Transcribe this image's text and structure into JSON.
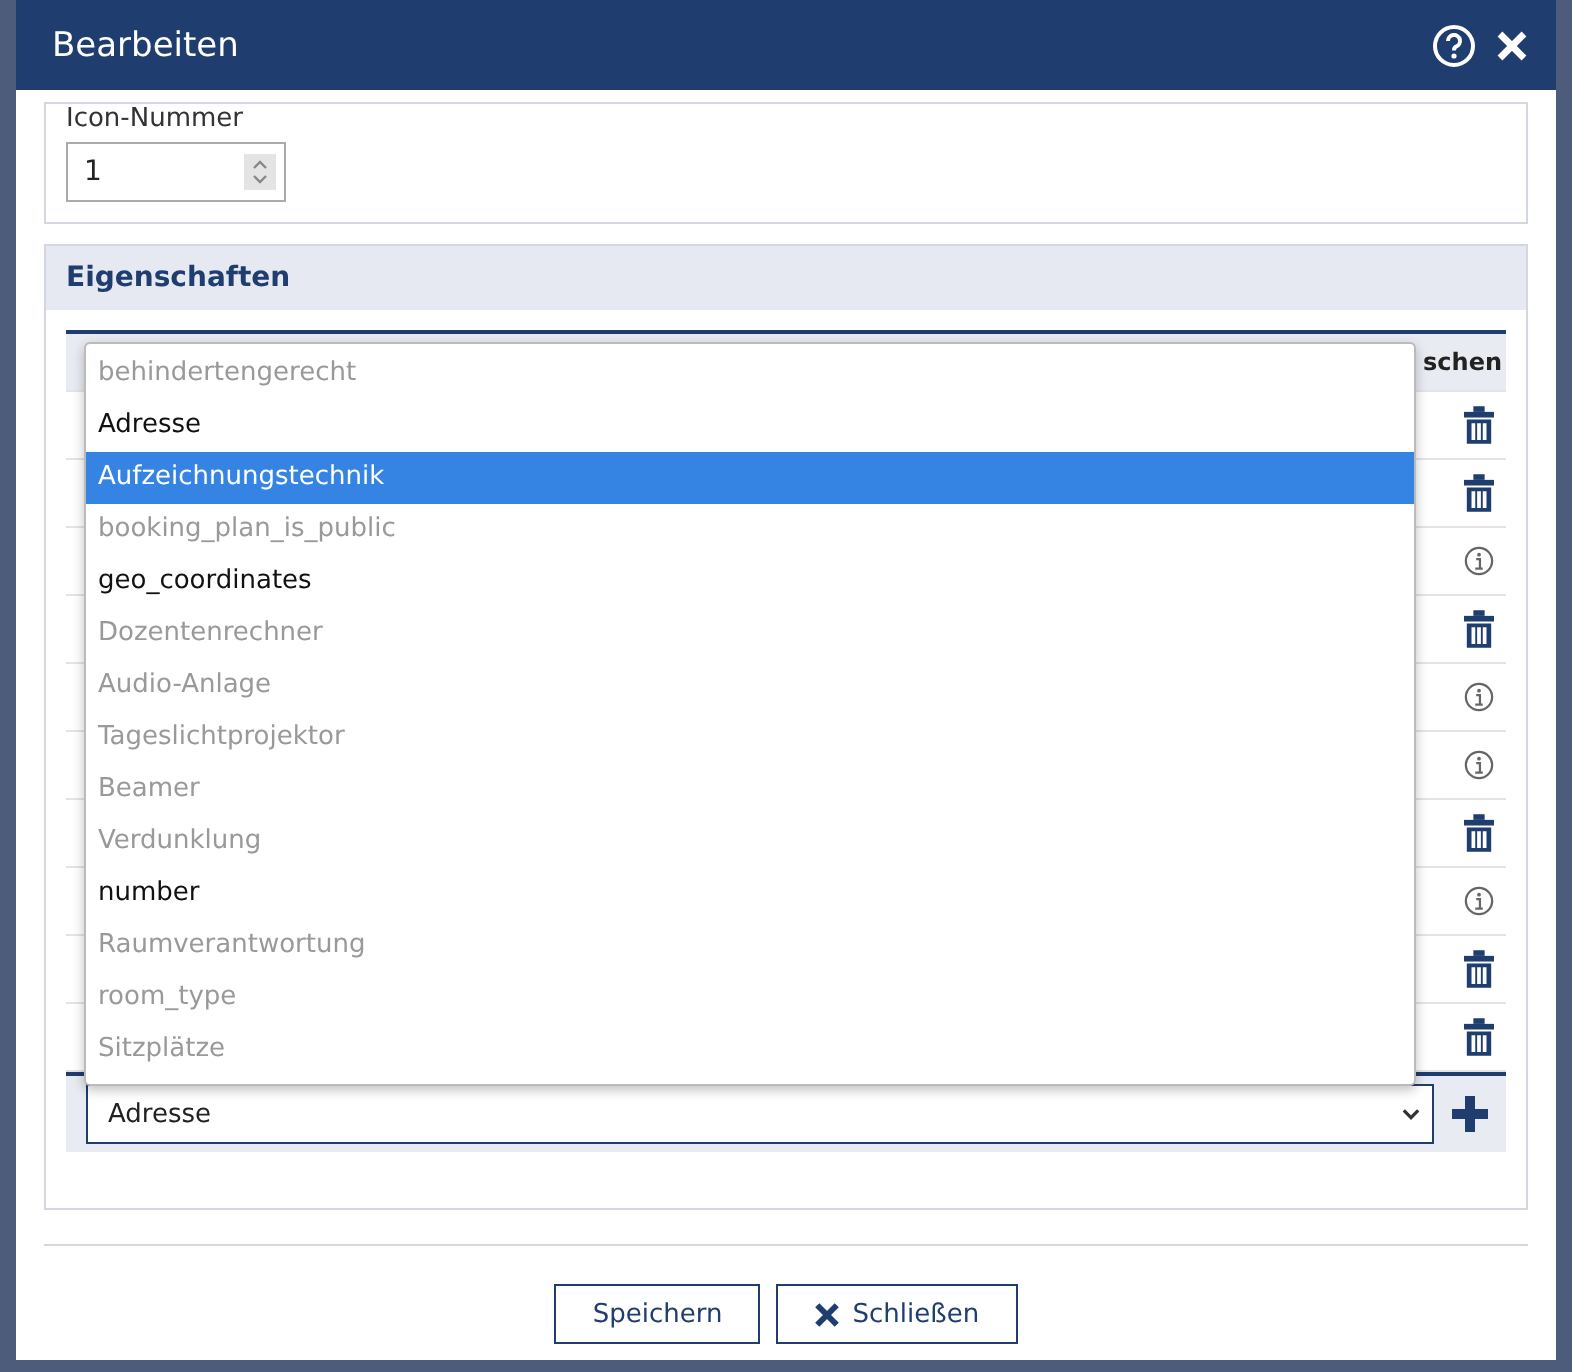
{
  "dialog": {
    "title": "Bearbeiten"
  },
  "icon_field": {
    "label": "Icon-Nummer",
    "value": "1"
  },
  "properties": {
    "title": "Eigenschaften",
    "column_2": {
      "label": "schen"
    },
    "rows": [
      {
        "kind": "delete"
      },
      {
        "kind": "delete"
      },
      {
        "kind": "info"
      },
      {
        "kind": "delete"
      },
      {
        "kind": "info"
      },
      {
        "kind": "info"
      },
      {
        "kind": "delete"
      },
      {
        "kind": "info"
      },
      {
        "kind": "delete"
      },
      {
        "kind": "delete"
      }
    ],
    "select": {
      "value": "Adresse"
    },
    "dropdown": [
      {
        "label": "behindertengerecht",
        "disabled": true,
        "selected": false
      },
      {
        "label": "Adresse",
        "disabled": false,
        "selected": false
      },
      {
        "label": "Aufzeichnungstechnik",
        "disabled": false,
        "selected": true
      },
      {
        "label": "booking_plan_is_public",
        "disabled": true,
        "selected": false
      },
      {
        "label": "geo_coordinates",
        "disabled": false,
        "selected": false
      },
      {
        "label": "Dozentenrechner",
        "disabled": true,
        "selected": false
      },
      {
        "label": "Audio-Anlage",
        "disabled": true,
        "selected": false
      },
      {
        "label": "Tageslichtprojektor",
        "disabled": true,
        "selected": false
      },
      {
        "label": "Beamer",
        "disabled": true,
        "selected": false
      },
      {
        "label": "Verdunklung",
        "disabled": true,
        "selected": false
      },
      {
        "label": "number",
        "disabled": false,
        "selected": false
      },
      {
        "label": "Raumverantwortung",
        "disabled": true,
        "selected": false
      },
      {
        "label": "room_type",
        "disabled": true,
        "selected": false
      },
      {
        "label": "Sitzplätze",
        "disabled": true,
        "selected": false
      }
    ]
  },
  "buttons": [
    {
      "label": "Speichern",
      "kind": "save"
    },
    {
      "label": "Schließen",
      "kind": "close"
    }
  ]
}
